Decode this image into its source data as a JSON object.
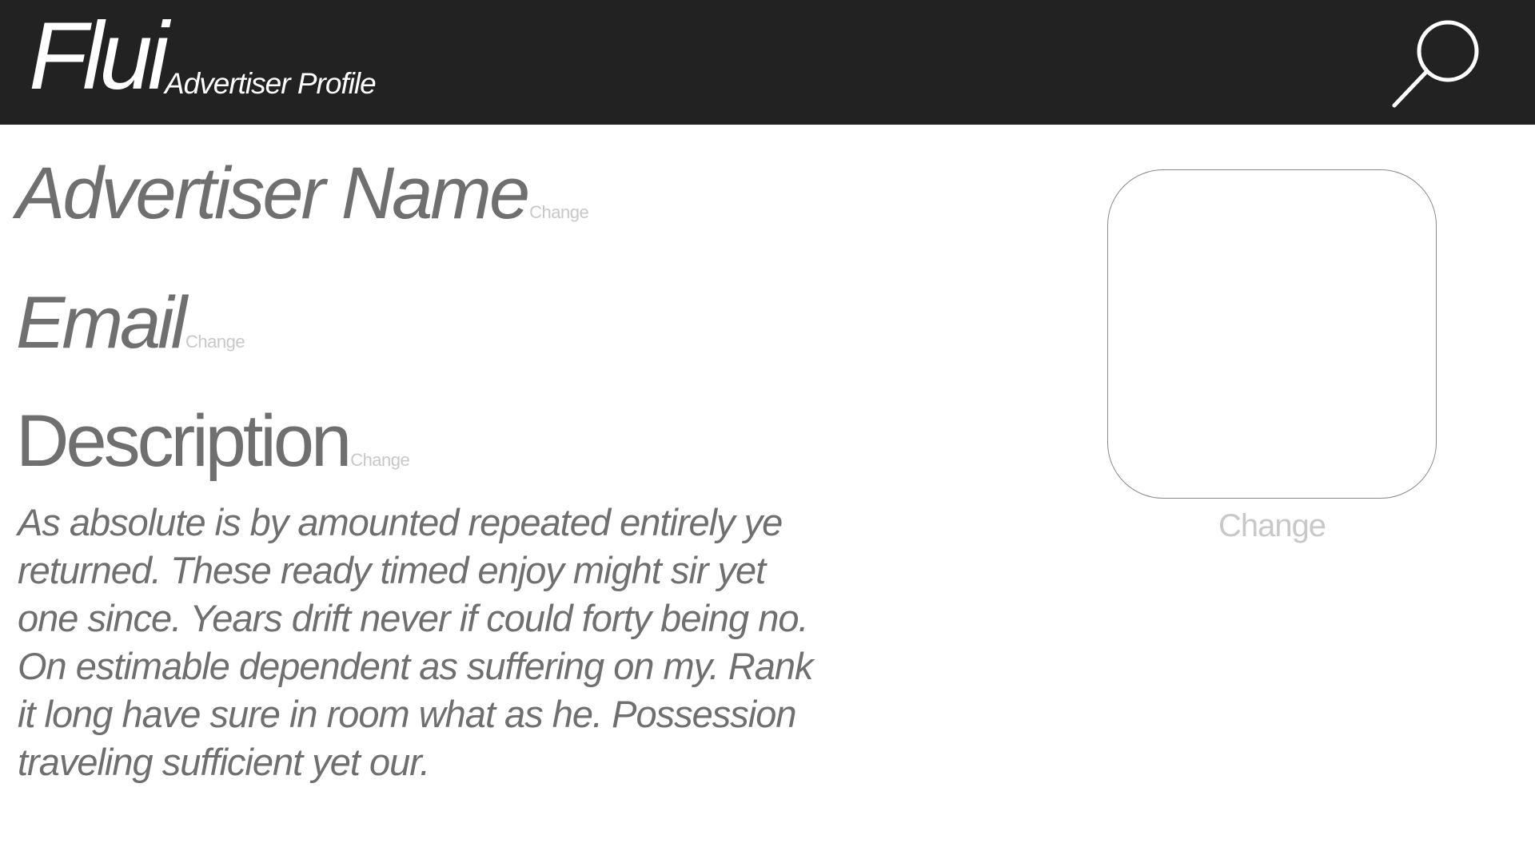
{
  "header": {
    "brand": "Flui",
    "subtitle": "Advertiser Profile",
    "search_icon": "search-icon",
    "background_color": "#222222"
  },
  "profile": {
    "name_label": "Advertiser Name",
    "email_label": "Email",
    "description_label": "Description",
    "change_label": "Change",
    "description_text": "As absolute is by amounted repeated entirely ye returned. These ready timed enjoy might sir yet one since. Years drift never if could forty being no. On estimable dependent as suffering on my. Rank it long have sure in room what as he. Possession traveling sufficient yet our.",
    "avatar_change_label": "Change"
  },
  "colors": {
    "text": "#6f6f6f",
    "muted": "#c8c8c8"
  }
}
